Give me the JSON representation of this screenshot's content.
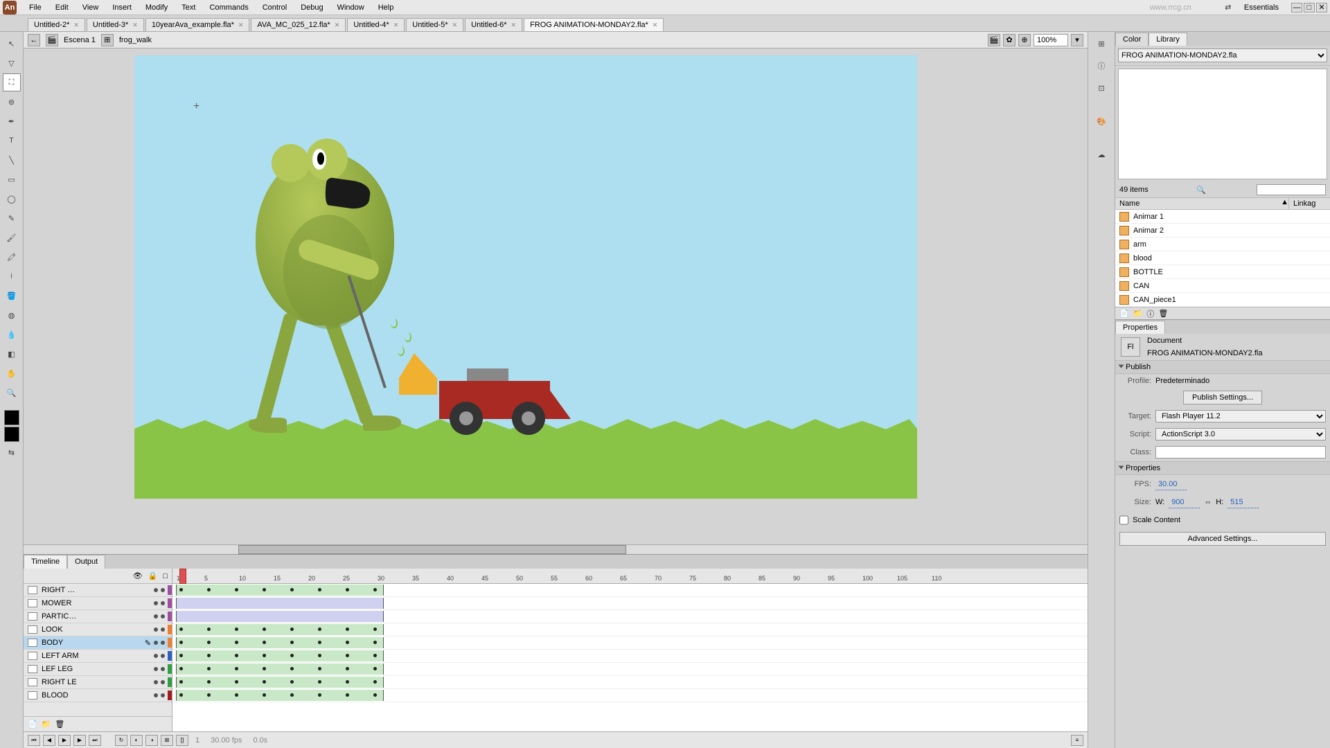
{
  "menu": [
    "File",
    "Edit",
    "View",
    "Insert",
    "Modify",
    "Text",
    "Commands",
    "Control",
    "Debug",
    "Window",
    "Help"
  ],
  "watermark": "www.rrcg.cn",
  "workspace": "Essentials",
  "tabs": [
    {
      "label": "Untitled-2*"
    },
    {
      "label": "Untitled-3*"
    },
    {
      "label": "10yearAva_example.fla*"
    },
    {
      "label": "AVA_MC_025_12.fla*"
    },
    {
      "label": "Untitled-4*"
    },
    {
      "label": "Untitled-5*"
    },
    {
      "label": "Untitled-6*"
    },
    {
      "label": "FROG ANIMATION-MONDAY2.fla*",
      "active": true
    }
  ],
  "path": {
    "scene": "Escena 1",
    "symbol": "frog_walk",
    "zoom": "100%"
  },
  "timeline": {
    "tabs": [
      "Timeline",
      "Output"
    ],
    "layers": [
      {
        "name": "RIGHT …",
        "color": "#a050a0"
      },
      {
        "name": "MOWER",
        "color": "#a050a0"
      },
      {
        "name": "PARTIC…",
        "color": "#a050a0"
      },
      {
        "name": "LOOK",
        "color": "#f08030"
      },
      {
        "name": "BODY",
        "color": "#f08030",
        "sel": true
      },
      {
        "name": "LEFT ARM",
        "color": "#3060c0"
      },
      {
        "name": "LEF LEG",
        "color": "#30a040"
      },
      {
        "name": "RIGHT LE",
        "color": "#30a040"
      },
      {
        "name": "BLOOD",
        "color": "#a02020"
      }
    ],
    "ruler": [
      1,
      5,
      10,
      15,
      20,
      25,
      30,
      35,
      40,
      45,
      50,
      55,
      60,
      65,
      70,
      75,
      80,
      85,
      90,
      95,
      100,
      105,
      110
    ],
    "frame": "1",
    "fps": "30.00 fps",
    "time": "0.0s"
  },
  "library": {
    "tabs": [
      "Color",
      "Library"
    ],
    "file": "FROG ANIMATION-MONDAY2.fla",
    "count": "49 items",
    "cols": [
      "Name",
      "Linkag"
    ],
    "items": [
      "Animar 1",
      "Animar 2",
      "arm",
      "blood",
      "BOTTLE",
      "CAN",
      "CAN_piece1"
    ]
  },
  "properties": {
    "tab": "Properties",
    "docLabel": "Document",
    "docName": "FROG ANIMATION-MONDAY2.fla",
    "publish": {
      "title": "Publish",
      "profileLabel": "Profile:",
      "profile": "Predeterminado",
      "settingsBtn": "Publish Settings...",
      "targetLabel": "Target:",
      "target": "Flash Player 11.2",
      "scriptLabel": "Script:",
      "script": "ActionScript 3.0",
      "classLabel": "Class:",
      "classVal": ""
    },
    "props": {
      "title": "Properties",
      "fpsLabel": "FPS:",
      "fps": "30.00",
      "sizeLabel": "Size:",
      "w": "900",
      "h": "515",
      "scaleLabel": "Scale Content",
      "advBtn": "Advanced Settings..."
    }
  }
}
